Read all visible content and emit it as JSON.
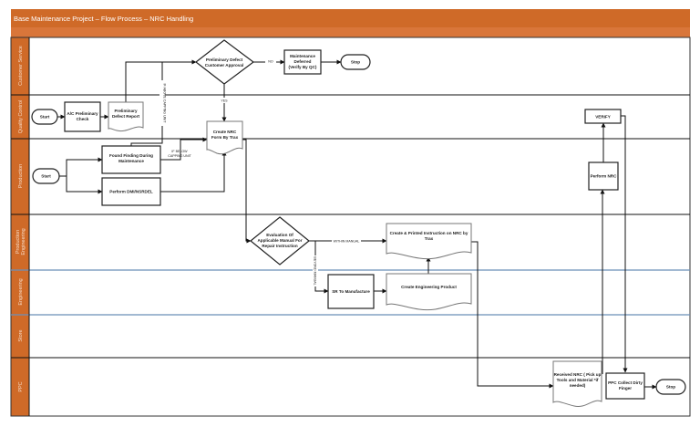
{
  "header": {
    "title": "Base Maintenance Project – Flow Process – NRC Handling"
  },
  "colors": {
    "header": "#cf6a28",
    "header_band": "#d9763a",
    "lane_label": "#cf6a28",
    "engineering_border": "#6b8fb8"
  },
  "lanes": [
    {
      "label": "Customer Service"
    },
    {
      "label": "Quality Control"
    },
    {
      "label": "Production"
    },
    {
      "label": [
        "Production",
        "Engineering"
      ]
    },
    {
      "label": "Engineering"
    },
    {
      "label": "Store"
    },
    {
      "label": "PPC"
    }
  ],
  "nodes": {
    "approval": [
      "Preliminary Defect",
      "Customer Approval"
    ],
    "deferred": [
      "Maintenance",
      "Deferred",
      "(Verify By QC)"
    ],
    "stop1": "Stop",
    "qc_start": "Start",
    "ac_check": [
      "A/C Preliminary",
      "Check"
    ],
    "defect_report": [
      "Preliminary",
      "Defect Report"
    ],
    "create_nrc": [
      "Create NRC",
      "Form By Trax"
    ],
    "prod_start": "Start",
    "found_finding": [
      "Found Finding During",
      "Maintenance"
    ],
    "perform_dmi": "Perform DMI/NSRDEL",
    "evaluation": [
      "Evaluation Of",
      "Applicable Manual For",
      "Repair Instruction"
    ],
    "create_printed": [
      "Create & Printed Instruction on NRC by",
      "Trax"
    ],
    "sr_manufacture": "SR To Manufacture",
    "eng_product": "Create Engineering Product",
    "verify": "VERIFY",
    "perform_nrc": "Perform NRC",
    "received_nrc": [
      "Received NRC ( Pick up",
      "Tools and Material *if",
      "needed)"
    ],
    "ppc_collect": [
      "PPC Collect Dirty",
      "Finger"
    ],
    "stop2": "Stop"
  },
  "edge_labels": {
    "no": "NO",
    "yes": "YES",
    "above_capping": "IF ABOVE CAPPING UNIT",
    "below_capping": [
      "IF BELOW",
      "CAPPING UNIT"
    ],
    "within_manual": "WITHIN MANUAL",
    "beyond_manual": "BEYOND MANUAL"
  }
}
